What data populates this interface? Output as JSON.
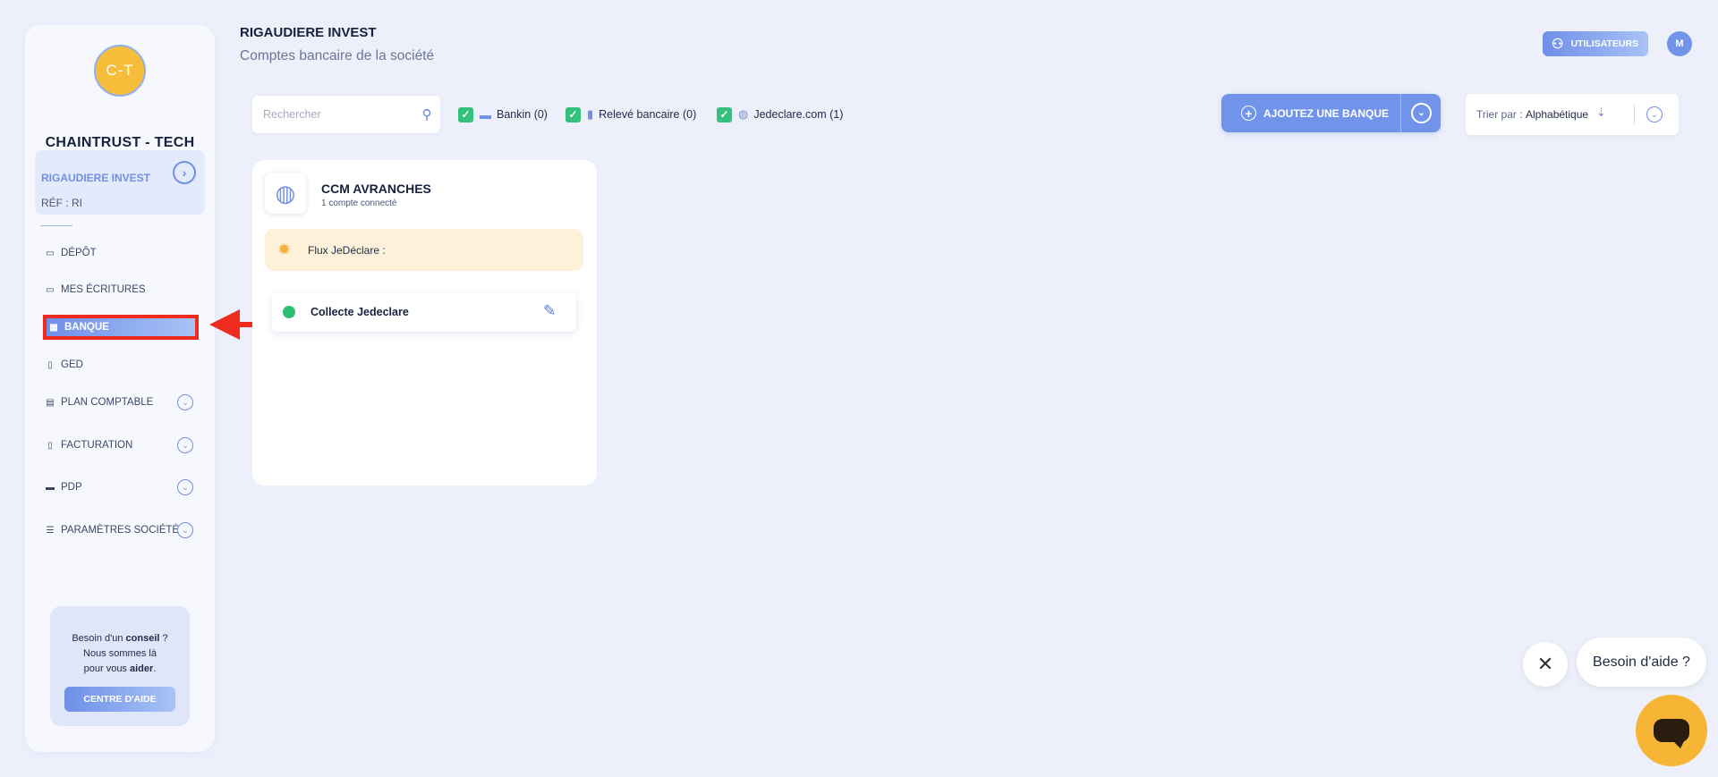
{
  "sidebar": {
    "avatar_initials": "C-T",
    "company_name": "CHAINTRUST - TECH",
    "entity": {
      "name": "RIGAUDIERE INVEST",
      "ref": "RÉF : RI"
    },
    "items": [
      {
        "label": "DÉPÔT",
        "icon": "folder-upload-icon"
      },
      {
        "label": "MES ÉCRITURES",
        "icon": "folder-sync-icon"
      },
      {
        "label": "BANQUE",
        "icon": "bank-icon",
        "active": true
      },
      {
        "label": "GED",
        "icon": "document-search-icon"
      },
      {
        "label": "PLAN COMPTABLE",
        "icon": "ledger-icon"
      },
      {
        "label": "FACTURATION",
        "icon": "invoice-icon"
      },
      {
        "label": "PDP",
        "icon": "card-icon"
      },
      {
        "label": "PARAMÈTRES SOCIÉTÉ",
        "icon": "sliders-icon"
      }
    ],
    "help": {
      "line1_pre": "Besoin d'un ",
      "line1_bold": "conseil",
      "line1_post": " ?",
      "line2": "Nous sommes là",
      "line3_pre": "pour vous ",
      "line3_bold": "aider",
      "line3_post": ".",
      "button": "CENTRE D'AIDE"
    }
  },
  "header": {
    "title": "RIGAUDIERE INVEST",
    "subtitle": "Comptes bancaire de la société",
    "users_button": "UTILISATEURS",
    "user_initial": "M"
  },
  "toolbar": {
    "search_placeholder": "Rechercher",
    "filters": [
      {
        "label": "Bankin (0)",
        "checked": true,
        "icon": "card-icon"
      },
      {
        "label": "Relevé bancaire (0)",
        "checked": true,
        "icon": "document-icon"
      },
      {
        "label": "Jedeclare.com (1)",
        "checked": true,
        "icon": "globe-icon"
      }
    ],
    "add_bank_button": "AJOUTEZ UNE BANQUE",
    "sort_label": "Trier par :",
    "sort_value": "Alphabétique"
  },
  "bank_card": {
    "name": "CCM AVRANCHES",
    "subtitle": "1 compte connecté",
    "flux_label": "Flux JeDéclare :",
    "accounts": [
      {
        "name": "Collecte Jedeclare",
        "status": "connected"
      }
    ]
  },
  "chat": {
    "bubble_text": "Besoin d'aide ?"
  },
  "colors": {
    "accent": "#6f90e6",
    "highlight_annotation": "#ee2b1e",
    "status_green": "#34c17b",
    "chat_yellow": "#f6b534"
  }
}
